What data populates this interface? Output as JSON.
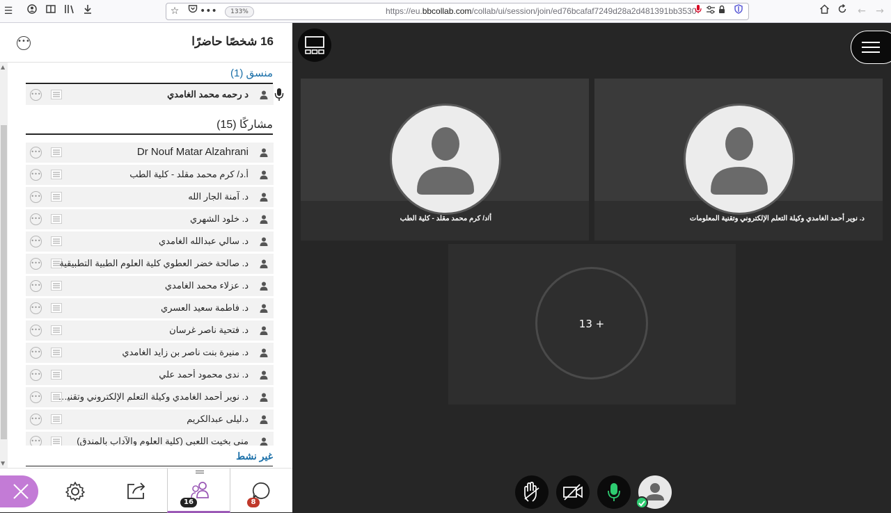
{
  "browser": {
    "url_prefix": "https://eu.",
    "url_domain": "bbcollab.com",
    "url_path": "/collab/ui/session/join/ed76bcafaf7249d28a2d481391bb3530",
    "zoom": "133%"
  },
  "panel": {
    "title": "16 شخصًا حاضرًا",
    "moderator_section": "منسق (1)",
    "participant_section": "مشاركًا (15)",
    "inactive_section": "غير نشط",
    "moderator": "د رحمه محمد الغامدي",
    "participants": [
      "Dr Nouf Matar Alzahrani",
      "أ.د/ كرم محمد مقلد - كلية الطب",
      "د. آمنة الجار الله",
      "د. خلود الشهري",
      "د. سالي عبدالله الغامدي",
      "د. صالحة خضر العطوي كلية العلوم الطبية التطبيقية",
      "د. عزلاء محمد الغامدي",
      "د. فاطمة سعيد العسري",
      "د. فتحية ناصر غرسان",
      "د. منيرة بنت ناصر بن زايد الغامدي",
      "د. ندى محمود أحمد علي",
      "د. نوير أحمد الغامدي وكيلة التعلم الإلكتروني وتقنية المعلومات",
      "د.ليلى عبدالكريم",
      "منى بخيت اللعبي (كلية العلوم والآداب بالمندق)"
    ]
  },
  "tabs": {
    "attendees_count": "16",
    "chat_count": "8"
  },
  "stage": {
    "tile_left_name": "أ/د/ كرم محمد مقلد - كلية الطب",
    "tile_right_name": "د. نوير أحمد الغامدي وكيلة التعلم الإلكتروني وتقنية المعلومات",
    "more_label": "13 +"
  },
  "colors": {
    "accent": "#1a6fa8",
    "close_button": "#c37bd6",
    "mic_green": "#2ecc71",
    "badge_red": "#c0392b"
  }
}
